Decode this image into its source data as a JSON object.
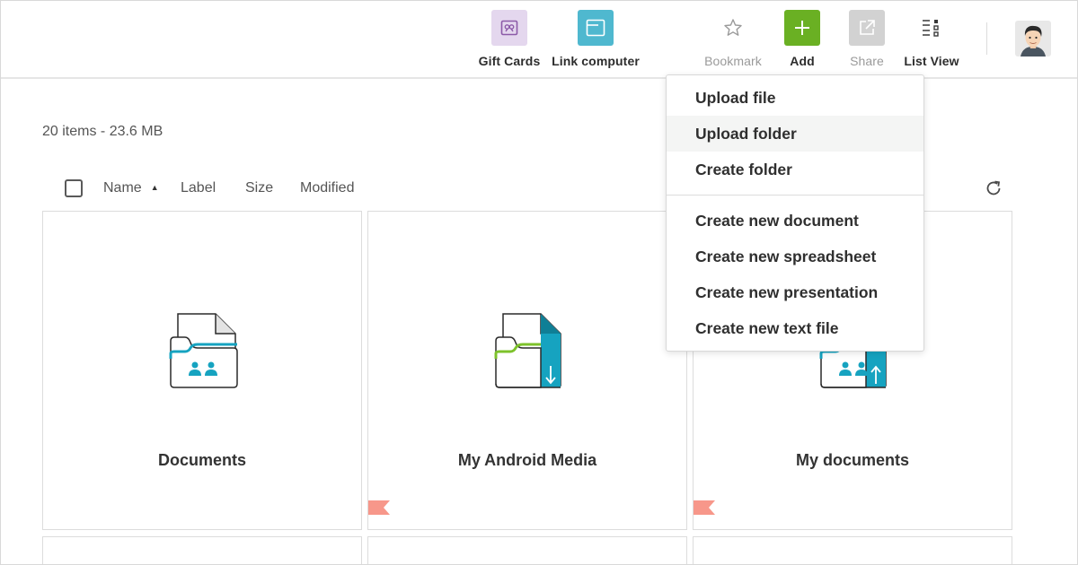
{
  "toolbar": {
    "gift_cards": {
      "label": "Gift Cards",
      "icon": "gift-card-icon",
      "color": "#e4d7ee"
    },
    "link_computer": {
      "label": "Link computer",
      "icon": "window-icon",
      "color": "#4fb8cf"
    },
    "bookmark": {
      "label": "Bookmark",
      "icon": "star-icon"
    },
    "add": {
      "label": "Add",
      "icon": "plus-icon",
      "color": "#6ab023"
    },
    "share": {
      "label": "Share",
      "icon": "external-link-icon",
      "color": "#d2d2d2"
    },
    "list_view": {
      "label": "List View",
      "icon": "list-view-icon"
    },
    "avatar": {
      "icon": "user-avatar-icon"
    }
  },
  "content": {
    "summary": "20 items - 23.6 MB",
    "columns": {
      "name": "Name",
      "label": "Label",
      "size": "Size",
      "modified": "Modified"
    },
    "sort": {
      "column": "Name",
      "direction": "ascending"
    }
  },
  "items": [
    {
      "name": "Documents",
      "icon": "shared-folder-icon",
      "flagged": false
    },
    {
      "name": "My Android Media",
      "icon": "download-folder-icon",
      "flagged": true
    },
    {
      "name": "My documents",
      "icon": "upload-folder-icon",
      "flagged": true
    }
  ],
  "add_menu": {
    "items": [
      {
        "label": "Upload file"
      },
      {
        "label": "Upload folder",
        "hovered": true
      },
      {
        "label": "Create folder"
      },
      {
        "label": "Create new document"
      },
      {
        "label": "Create new spreadsheet"
      },
      {
        "label": "Create new presentation"
      },
      {
        "label": "Create new text file"
      }
    ]
  },
  "colors": {
    "accent_teal": "#16a3c0",
    "accent_green": "#7dc22b",
    "flag": "#f7978a"
  }
}
